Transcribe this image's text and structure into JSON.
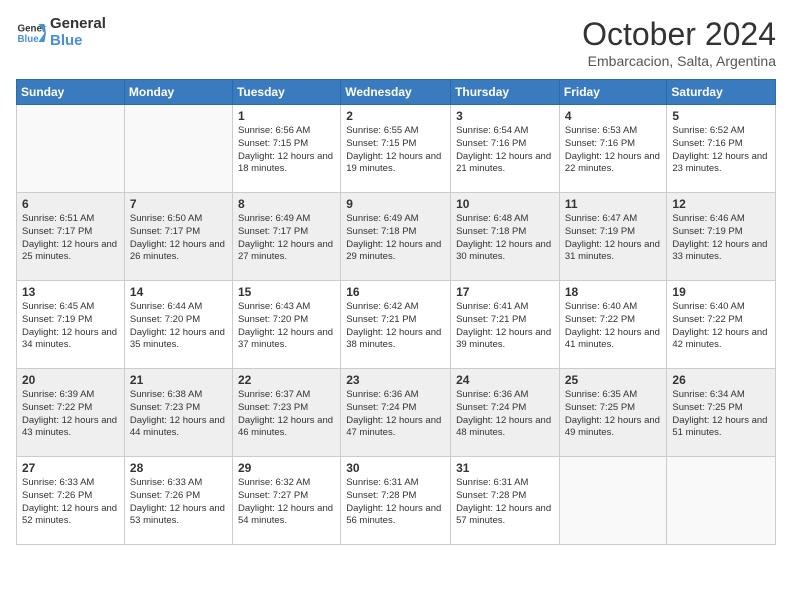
{
  "logo": {
    "line1": "General",
    "line2": "Blue"
  },
  "title": {
    "month_year": "October 2024",
    "location": "Embarcacion, Salta, Argentina"
  },
  "days_of_week": [
    "Sunday",
    "Monday",
    "Tuesday",
    "Wednesday",
    "Thursday",
    "Friday",
    "Saturday"
  ],
  "weeks": [
    [
      {
        "day": "",
        "info": ""
      },
      {
        "day": "",
        "info": ""
      },
      {
        "day": "1",
        "info": "Sunrise: 6:56 AM\nSunset: 7:15 PM\nDaylight: 12 hours and 18 minutes."
      },
      {
        "day": "2",
        "info": "Sunrise: 6:55 AM\nSunset: 7:15 PM\nDaylight: 12 hours and 19 minutes."
      },
      {
        "day": "3",
        "info": "Sunrise: 6:54 AM\nSunset: 7:16 PM\nDaylight: 12 hours and 21 minutes."
      },
      {
        "day": "4",
        "info": "Sunrise: 6:53 AM\nSunset: 7:16 PM\nDaylight: 12 hours and 22 minutes."
      },
      {
        "day": "5",
        "info": "Sunrise: 6:52 AM\nSunset: 7:16 PM\nDaylight: 12 hours and 23 minutes."
      }
    ],
    [
      {
        "day": "6",
        "info": "Sunrise: 6:51 AM\nSunset: 7:17 PM\nDaylight: 12 hours and 25 minutes."
      },
      {
        "day": "7",
        "info": "Sunrise: 6:50 AM\nSunset: 7:17 PM\nDaylight: 12 hours and 26 minutes."
      },
      {
        "day": "8",
        "info": "Sunrise: 6:49 AM\nSunset: 7:17 PM\nDaylight: 12 hours and 27 minutes."
      },
      {
        "day": "9",
        "info": "Sunrise: 6:49 AM\nSunset: 7:18 PM\nDaylight: 12 hours and 29 minutes."
      },
      {
        "day": "10",
        "info": "Sunrise: 6:48 AM\nSunset: 7:18 PM\nDaylight: 12 hours and 30 minutes."
      },
      {
        "day": "11",
        "info": "Sunrise: 6:47 AM\nSunset: 7:19 PM\nDaylight: 12 hours and 31 minutes."
      },
      {
        "day": "12",
        "info": "Sunrise: 6:46 AM\nSunset: 7:19 PM\nDaylight: 12 hours and 33 minutes."
      }
    ],
    [
      {
        "day": "13",
        "info": "Sunrise: 6:45 AM\nSunset: 7:19 PM\nDaylight: 12 hours and 34 minutes."
      },
      {
        "day": "14",
        "info": "Sunrise: 6:44 AM\nSunset: 7:20 PM\nDaylight: 12 hours and 35 minutes."
      },
      {
        "day": "15",
        "info": "Sunrise: 6:43 AM\nSunset: 7:20 PM\nDaylight: 12 hours and 37 minutes."
      },
      {
        "day": "16",
        "info": "Sunrise: 6:42 AM\nSunset: 7:21 PM\nDaylight: 12 hours and 38 minutes."
      },
      {
        "day": "17",
        "info": "Sunrise: 6:41 AM\nSunset: 7:21 PM\nDaylight: 12 hours and 39 minutes."
      },
      {
        "day": "18",
        "info": "Sunrise: 6:40 AM\nSunset: 7:22 PM\nDaylight: 12 hours and 41 minutes."
      },
      {
        "day": "19",
        "info": "Sunrise: 6:40 AM\nSunset: 7:22 PM\nDaylight: 12 hours and 42 minutes."
      }
    ],
    [
      {
        "day": "20",
        "info": "Sunrise: 6:39 AM\nSunset: 7:22 PM\nDaylight: 12 hours and 43 minutes."
      },
      {
        "day": "21",
        "info": "Sunrise: 6:38 AM\nSunset: 7:23 PM\nDaylight: 12 hours and 44 minutes."
      },
      {
        "day": "22",
        "info": "Sunrise: 6:37 AM\nSunset: 7:23 PM\nDaylight: 12 hours and 46 minutes."
      },
      {
        "day": "23",
        "info": "Sunrise: 6:36 AM\nSunset: 7:24 PM\nDaylight: 12 hours and 47 minutes."
      },
      {
        "day": "24",
        "info": "Sunrise: 6:36 AM\nSunset: 7:24 PM\nDaylight: 12 hours and 48 minutes."
      },
      {
        "day": "25",
        "info": "Sunrise: 6:35 AM\nSunset: 7:25 PM\nDaylight: 12 hours and 49 minutes."
      },
      {
        "day": "26",
        "info": "Sunrise: 6:34 AM\nSunset: 7:25 PM\nDaylight: 12 hours and 51 minutes."
      }
    ],
    [
      {
        "day": "27",
        "info": "Sunrise: 6:33 AM\nSunset: 7:26 PM\nDaylight: 12 hours and 52 minutes."
      },
      {
        "day": "28",
        "info": "Sunrise: 6:33 AM\nSunset: 7:26 PM\nDaylight: 12 hours and 53 minutes."
      },
      {
        "day": "29",
        "info": "Sunrise: 6:32 AM\nSunset: 7:27 PM\nDaylight: 12 hours and 54 minutes."
      },
      {
        "day": "30",
        "info": "Sunrise: 6:31 AM\nSunset: 7:28 PM\nDaylight: 12 hours and 56 minutes."
      },
      {
        "day": "31",
        "info": "Sunrise: 6:31 AM\nSunset: 7:28 PM\nDaylight: 12 hours and 57 minutes."
      },
      {
        "day": "",
        "info": ""
      },
      {
        "day": "",
        "info": ""
      }
    ]
  ]
}
